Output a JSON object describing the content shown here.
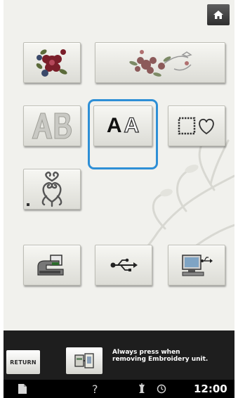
{
  "header": {
    "home_icon": "home-icon"
  },
  "pattern_buttons": [
    {
      "name": "floral-pattern-button",
      "icon": "flower-icon"
    },
    {
      "name": "bird-floral-pattern-button",
      "icon": "bird-flowers-icon"
    },
    {
      "name": "ornamental-letters-button",
      "icon": "ornamental-ab-icon"
    },
    {
      "name": "character-pattern-button",
      "icon": "character-aa-icon",
      "label": "A",
      "label2": "A",
      "selected": true
    },
    {
      "name": "frame-pattern-button",
      "icon": "frame-heart-icon"
    },
    {
      "name": "utility-pattern-button",
      "icon": "ornament-icon"
    },
    {
      "name": "machine-memory-button",
      "icon": "machine-memory-icon"
    },
    {
      "name": "usb-media-button",
      "icon": "usb-icon"
    },
    {
      "name": "computer-link-button",
      "icon": "computer-usb-icon"
    }
  ],
  "bottom_bar": {
    "return_label": "RETURN",
    "notice_line1": "Always press when",
    "notice_line2": "removing Embroidery unit."
  },
  "status_bar": {
    "time": "12:00",
    "help_label": "?",
    "icons": [
      "document-icon",
      "help-icon",
      "thread-icon",
      "clock-icon"
    ]
  },
  "colors": {
    "selection_outline": "#2e8fd6",
    "screen_background": "#f1f1ed",
    "bar_background": "#1e1e1e"
  }
}
